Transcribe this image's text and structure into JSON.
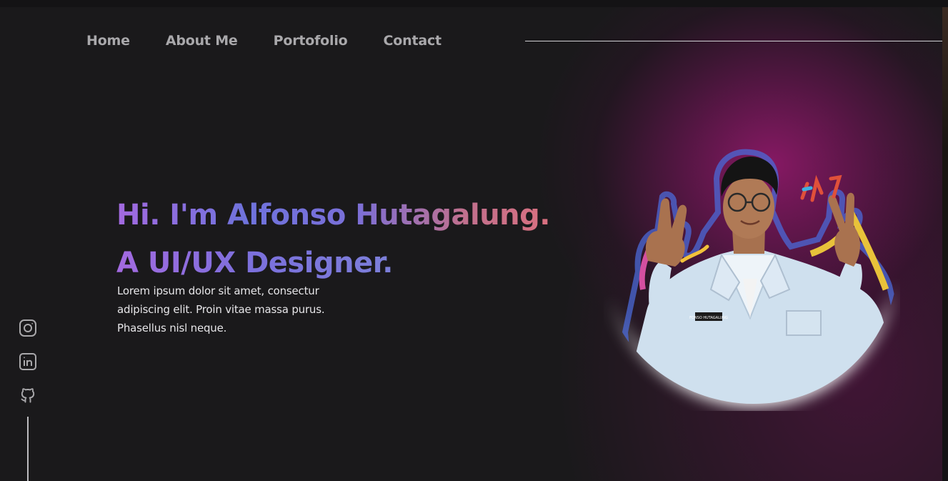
{
  "nav": {
    "items": [
      {
        "label": "Home"
      },
      {
        "label": "About Me"
      },
      {
        "label": "Portofolio"
      },
      {
        "label": "Contact"
      }
    ]
  },
  "hero": {
    "title_line1": "Hi. I'm Alfonso Hutagalung.",
    "title_line2": "A UI/UX Designer.",
    "description": "Lorem ipsum dolor sit amet, consectur adipiscing elit. Proin vitae massa purus. Phasellus nisl neque.",
    "badge_text": "FONSO HUTAGALUNG"
  },
  "social": {
    "icons": [
      "instagram-icon",
      "linkedin-icon",
      "github-icon"
    ]
  },
  "colors": {
    "background": "#1a191b",
    "nav_text": "#a9a8ab",
    "gradient_start": "#a36ae0",
    "gradient_mid": "#6f73dc",
    "gradient_end": "#d9707f",
    "glow": "#96196e"
  }
}
